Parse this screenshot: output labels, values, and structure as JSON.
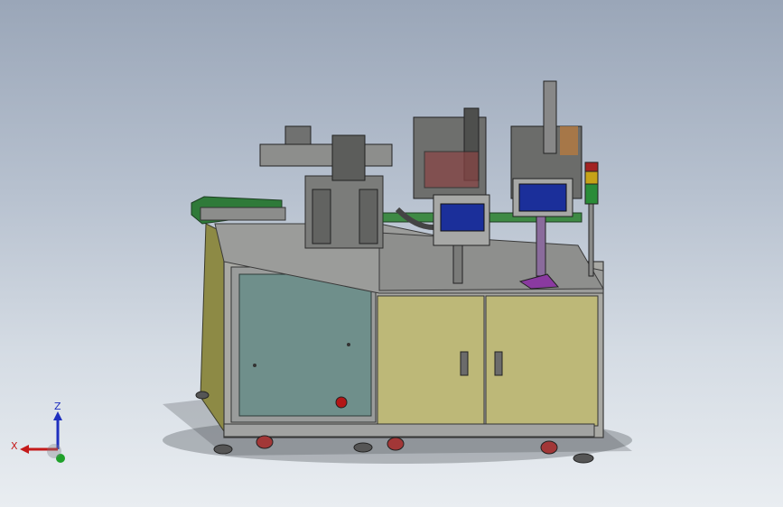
{
  "triad": {
    "x_label": "X",
    "z_label": "Z",
    "colors": {
      "x": "#c41a1a",
      "z": "#1f2fbf",
      "y": "#1fa12a"
    }
  }
}
